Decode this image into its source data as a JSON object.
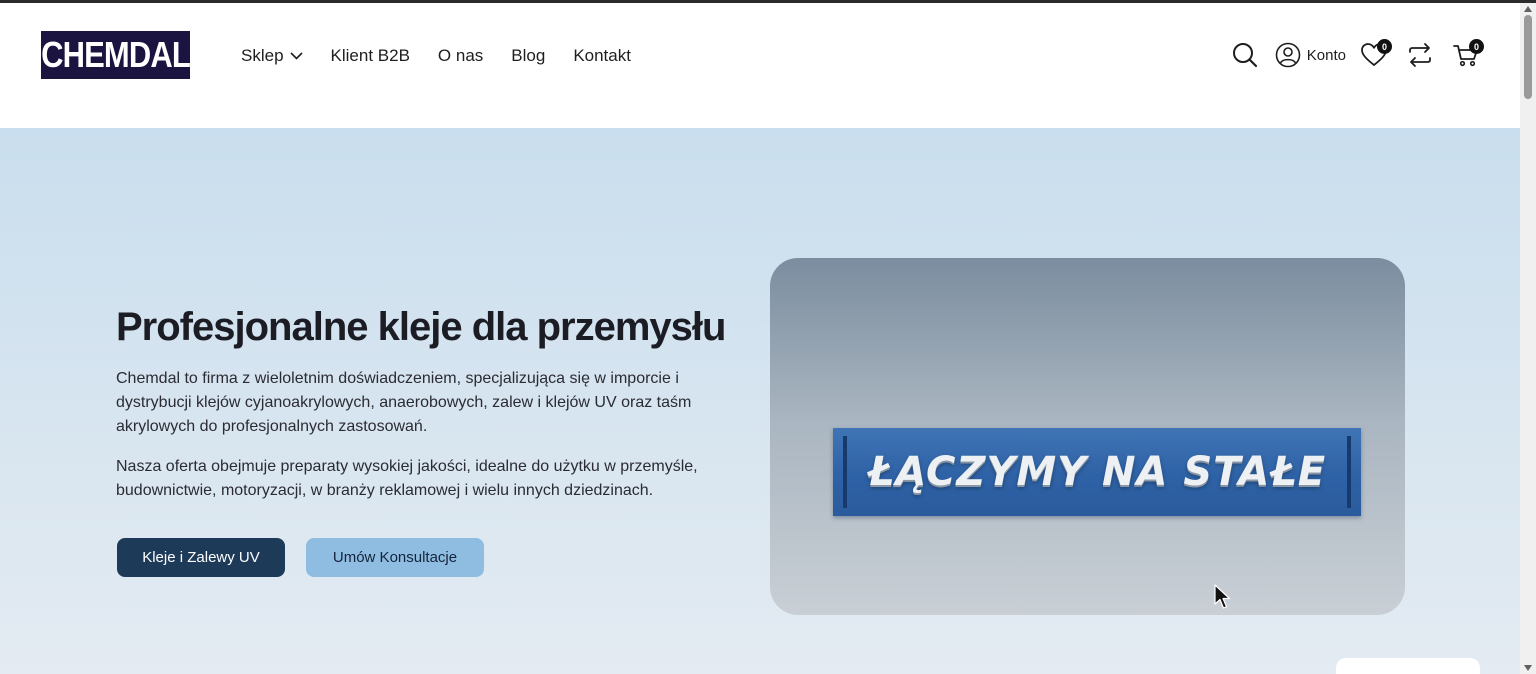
{
  "header": {
    "logo": "CHEMDAL",
    "nav": [
      {
        "label": "Sklep"
      },
      {
        "label": "Klient B2B"
      },
      {
        "label": "O nas"
      },
      {
        "label": "Blog"
      },
      {
        "label": "Kontakt"
      }
    ],
    "account_label": "Konto",
    "wishlist_count": "0",
    "cart_count": "0"
  },
  "hero": {
    "title": "Profesjonalne kleje dla przemysłu",
    "paragraph1": "Chemdal to firma z wieloletnim doświadczeniem, specjalizująca się w imporcie i dystrybucji klejów cyjanoakrylowych, anaerobowych, zalew i klejów UV oraz taśm akrylowych do profesjonalnych zastosowań.",
    "paragraph2": "Nasza oferta obejmuje preparaty wysokiej jakości, idealne do użytku w przemyśle, budownictwie, motoryzacji, w branży reklamowej i wielu innych dziedzinach.",
    "primary_button": "Kleje i Zalewy UV",
    "secondary_button": "Umów Konsultacje",
    "banner_text": "ŁĄCZYMY NA STAŁE"
  },
  "colors": {
    "logo_bg": "#1b1440",
    "primary_button": "#1d3a59",
    "secondary_button": "#8fbde2",
    "hero_bg": "#c9deee",
    "banner": "#2e62a6"
  }
}
